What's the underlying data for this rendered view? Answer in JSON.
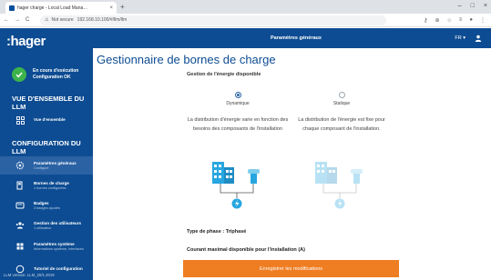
{
  "browser": {
    "tab_title": "hager charge - Local Load Mana…",
    "tab_close": "×",
    "new_tab": "+",
    "window_controls": [
      "–",
      "□",
      "×"
    ],
    "nav": [
      "←",
      "→",
      "C"
    ],
    "url_warning": "⚠",
    "url_not_secure": "Not secure",
    "url": "192.168.10.100/#/llm/llm"
  },
  "header": {
    "title": "Paramètres généraux",
    "lang": "FR ▾"
  },
  "sidebar": {
    "logo": ":hager",
    "status_line1": "En cours d'exécution",
    "status_line2": "Configuration OK",
    "section1": "VUE D'ENSEMBLE DU LLM",
    "section2": "CONFIGURATION DU LLM",
    "items": [
      {
        "label": "Vue d'ensemble",
        "sub": ""
      },
      {
        "label": "Paramètres généraux",
        "sub": "Configuré"
      },
      {
        "label": "Bornes de charge",
        "sub": "1 bornes configurées"
      },
      {
        "label": "Badges",
        "sub": "3 badges ajoutés"
      },
      {
        "label": "Gestion des utilisateurs",
        "sub": "1 utilisateur"
      },
      {
        "label": "Paramètres système",
        "sub": "Informations système, Interfaces"
      },
      {
        "label": "Tutoriel de configuration",
        "sub": ""
      }
    ],
    "version": "LLM version: LLM_20/1.2019"
  },
  "main": {
    "title": "Gestionnaire de bornes de charge",
    "energy_label": "Gestion de l'énergie disponible",
    "options": [
      {
        "name": "Dynamique",
        "desc": "La distribution d'énergie varie en fonction des besoins des composants de l'installation",
        "selected": true
      },
      {
        "name": "Statique",
        "desc": "La distribution de l'énergie est fixe pour chaque composant de l'installation.",
        "selected": false
      }
    ],
    "phase_label": "Type de phase :",
    "phase_value": "Triphasé",
    "current_label": "Courant maximal disponible pour l'installation (A)",
    "save_button": "Enregistrer les modifications"
  },
  "colors": {
    "brand_blue": "#0d4c92",
    "accent_orange": "#ef7d22",
    "status_green": "#3cb44b",
    "illus_blue": "#27a6e0"
  },
  "icons": [
    "check-icon",
    "grid-icon",
    "settings-icon",
    "charger-icon",
    "badge-icon",
    "users-icon",
    "system-icon",
    "help-icon",
    "user-icon",
    "building-icon",
    "ev-charger-icon",
    "lightning-icon"
  ]
}
